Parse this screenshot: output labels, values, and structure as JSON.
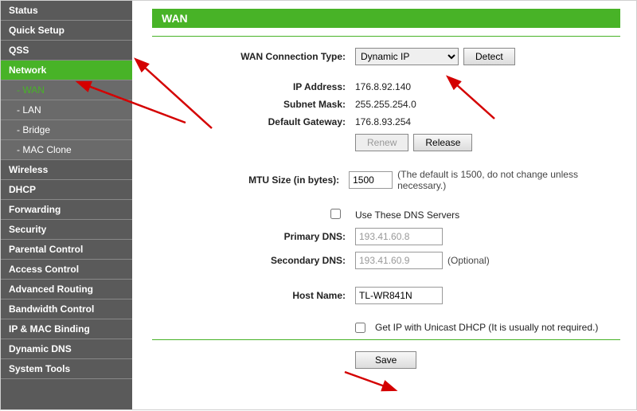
{
  "sidebar": {
    "items": [
      {
        "label": "Status",
        "type": "top"
      },
      {
        "label": "Quick Setup",
        "type": "top"
      },
      {
        "label": "QSS",
        "type": "top"
      },
      {
        "label": "Network",
        "type": "top",
        "selected": true
      },
      {
        "label": "- WAN",
        "type": "sub",
        "active": true
      },
      {
        "label": "- LAN",
        "type": "sub"
      },
      {
        "label": "- Bridge",
        "type": "sub"
      },
      {
        "label": "- MAC Clone",
        "type": "sub"
      },
      {
        "label": "Wireless",
        "type": "top"
      },
      {
        "label": "DHCP",
        "type": "top"
      },
      {
        "label": "Forwarding",
        "type": "top"
      },
      {
        "label": "Security",
        "type": "top"
      },
      {
        "label": "Parental Control",
        "type": "top"
      },
      {
        "label": "Access Control",
        "type": "top"
      },
      {
        "label": "Advanced Routing",
        "type": "top"
      },
      {
        "label": "Bandwidth Control",
        "type": "top"
      },
      {
        "label": "IP & MAC Binding",
        "type": "top"
      },
      {
        "label": "Dynamic DNS",
        "type": "top"
      },
      {
        "label": "System Tools",
        "type": "top"
      }
    ]
  },
  "page": {
    "title": "WAN"
  },
  "form": {
    "conn_type_label": "WAN Connection Type:",
    "conn_type_value": "Dynamic IP",
    "detect_label": "Detect",
    "ip_label": "IP Address:",
    "ip_value": "176.8.92.140",
    "mask_label": "Subnet Mask:",
    "mask_value": "255.255.254.0",
    "gw_label": "Default Gateway:",
    "gw_value": "176.8.93.254",
    "renew_label": "Renew",
    "release_label": "Release",
    "mtu_label": "MTU Size (in bytes):",
    "mtu_value": "1500",
    "mtu_note": "(The default is 1500, do not change unless necessary.)",
    "use_dns_label": "Use These DNS Servers",
    "pdns_label": "Primary DNS:",
    "pdns_value": "193.41.60.8",
    "sdns_label": "Secondary DNS:",
    "sdns_value": "193.41.60.9",
    "sdns_note": "(Optional)",
    "host_label": "Host Name:",
    "host_value": "TL-WR841N",
    "unicast_label": "Get IP with Unicast DHCP (It is usually not required.)",
    "save_label": "Save"
  }
}
